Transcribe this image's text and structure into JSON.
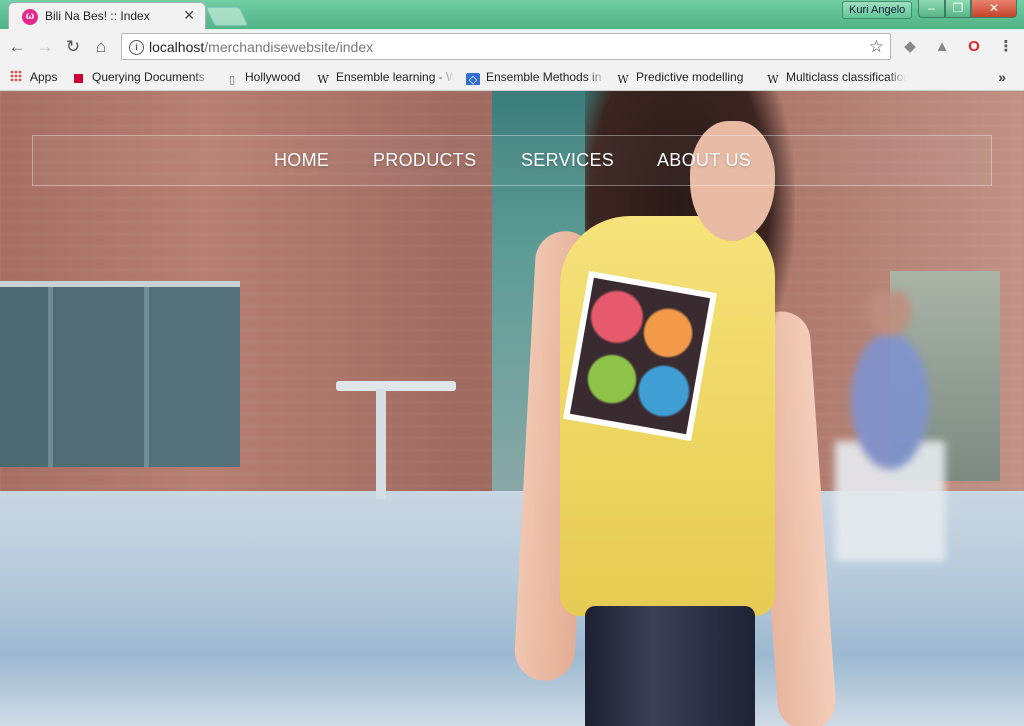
{
  "browser": {
    "tab": {
      "title": "Bili Na Bes! :: Index",
      "favicon_glyph": "ω",
      "close_glyph": "✕"
    },
    "profile_name": "Kuri Angelo",
    "window_controls": {
      "minimize": "–",
      "maximize": "❐",
      "close": "✕"
    },
    "url": {
      "host": "localhost",
      "path": "/merchandisewebsite/index"
    },
    "nav_icons": {
      "back": "←",
      "forward": "→",
      "reload": "↻",
      "home": "⌂",
      "star": "☆",
      "info": "i"
    },
    "extensions": {
      "ext1": "◆",
      "ext2": "▲",
      "opera": "O",
      "menu": "⋮"
    }
  },
  "bookmarks": {
    "items": [
      {
        "label": "Apps"
      },
      {
        "label": "Querying Documents"
      },
      {
        "label": "Hollywood"
      },
      {
        "label": "Ensemble learning - W"
      },
      {
        "label": "Ensemble Methods in"
      },
      {
        "label": "Predictive modelling"
      },
      {
        "label": "Multiclass classification"
      }
    ],
    "icons": {
      "wiki": "W",
      "doc": "▯",
      "ensemble": "◇"
    },
    "more": "»"
  },
  "site": {
    "nav": [
      {
        "label": "HOME"
      },
      {
        "label": "PRODUCTS"
      },
      {
        "label": "SERVICES"
      },
      {
        "label": "ABOUT US"
      }
    ]
  },
  "colors": {
    "titlebar": "#5fbf93",
    "toolbar": "#f2f2f2",
    "favicon": "#e5298c",
    "nav_text": "#ffffff",
    "shirt": "#f5e27a"
  }
}
